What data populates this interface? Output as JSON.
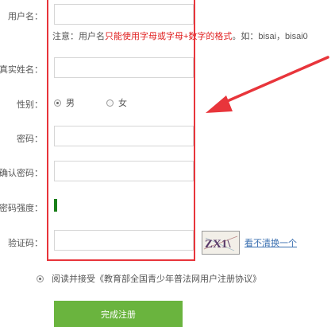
{
  "form": {
    "username_label": "用户名：",
    "username_value": "",
    "note_prefix": "注意：用户名",
    "note_red": "只能使用字母或字母+数字的格式",
    "note_suffix": "。如：bisai，bisai0",
    "realname_label": "真实姓名：",
    "gender_label": "性别：",
    "gender_options": [
      "男",
      "女"
    ],
    "gender_selected": "男",
    "password_label": "密码：",
    "confirm_password_label": "确认密码：",
    "strength_label": "密码强度：",
    "captcha_label": "验证码：",
    "captcha_image_text": "ZX1\\",
    "captcha_refresh_link": "看不清换一个",
    "agreement_text": "阅读并接受《教育部全国青少年普法网用户注册协议》",
    "submit_label": "完成注册"
  },
  "colors": {
    "highlight_border": "#e8353b",
    "arrow": "#e8353b",
    "note_emphasis": "#e02020",
    "strength_bar": "#1a7f1a",
    "submit_button": "#6ab43e",
    "link": "#3a6fb0"
  }
}
